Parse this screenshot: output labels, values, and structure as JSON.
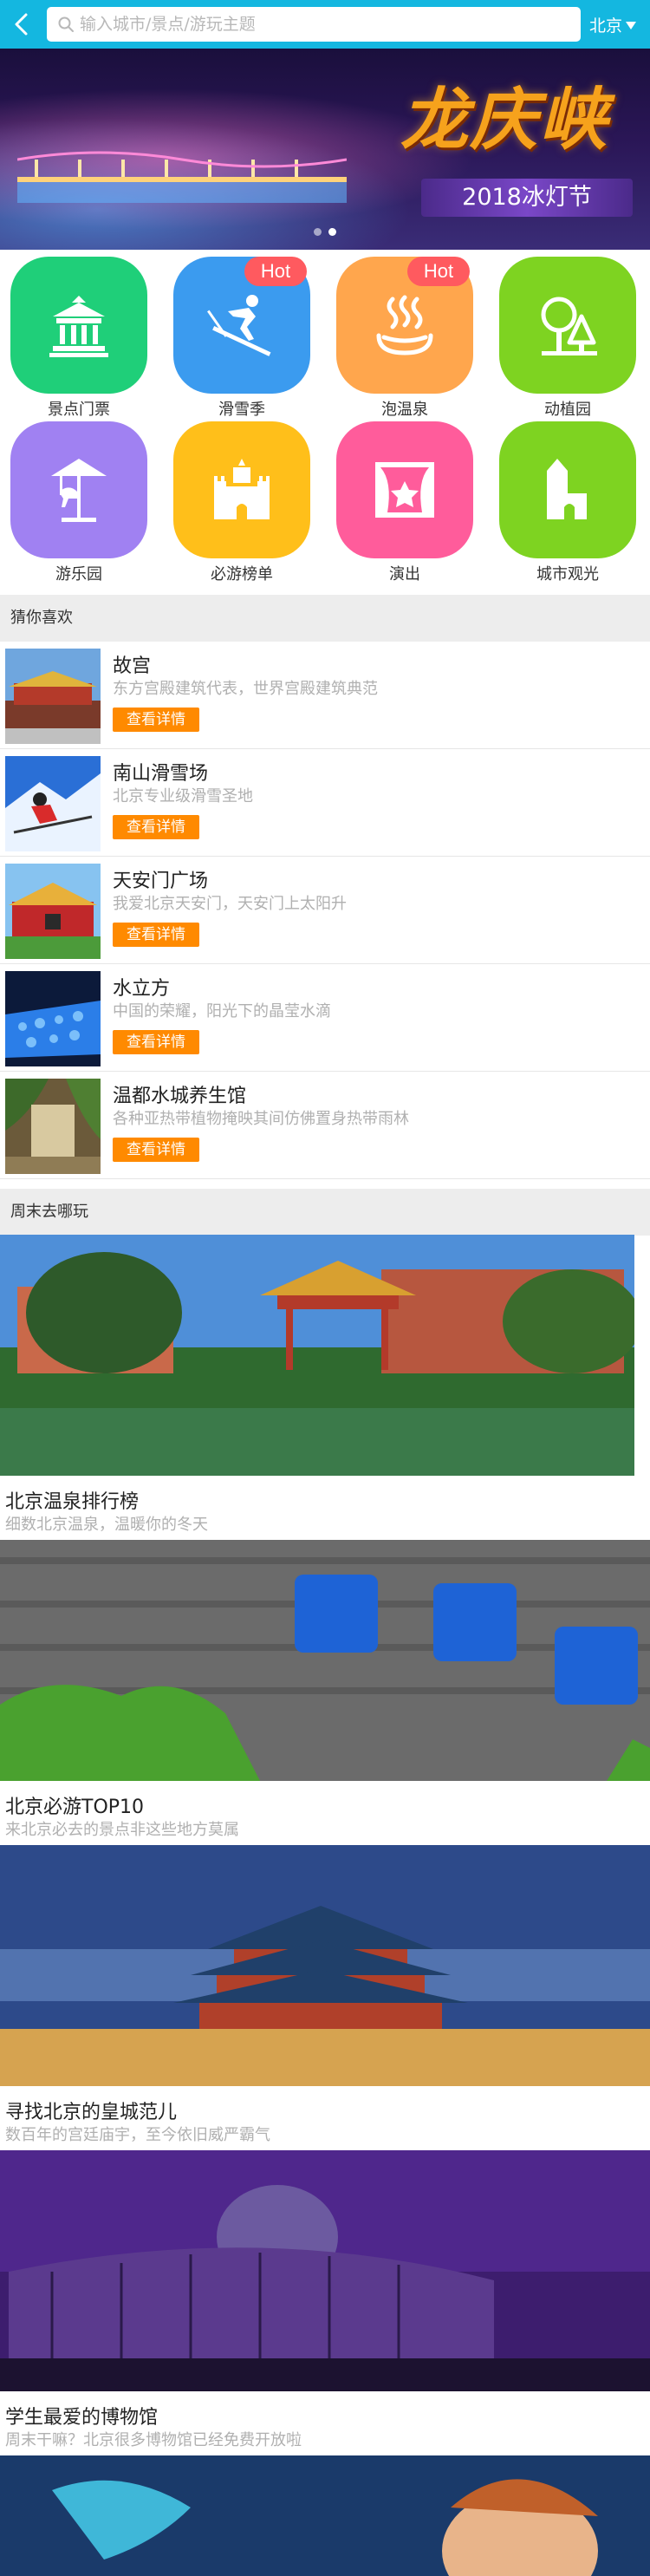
{
  "header": {
    "search_placeholder": "输入城市/景点/游玩主题",
    "city": "北京",
    "bar_color": "#14b7e0"
  },
  "banner": {
    "title": "龙庆峡",
    "subtitle": "2018冰灯节",
    "slide_count": 2,
    "active_slide": 1
  },
  "categories": [
    {
      "label": "景点门票",
      "color": "#1fcf79",
      "icon": "pavilion-icon",
      "hot": ""
    },
    {
      "label": "滑雪季",
      "color": "#3b9bef",
      "icon": "skier-icon",
      "hot": "Hot"
    },
    {
      "label": "泡温泉",
      "color": "#ffa64d",
      "icon": "hot-spring-icon",
      "hot": "Hot"
    },
    {
      "label": "动植园",
      "color": "#7ed321",
      "icon": "tree-icon",
      "hot": ""
    },
    {
      "label": "游乐园",
      "color": "#a081f2",
      "icon": "carousel-icon",
      "hot": ""
    },
    {
      "label": "必游榜单",
      "color": "#ffbf1a",
      "icon": "castle-icon",
      "hot": ""
    },
    {
      "label": "演出",
      "color": "#ff5c9b",
      "icon": "stage-icon",
      "hot": ""
    },
    {
      "label": "城市观光",
      "color": "#7ed321",
      "icon": "tower-icon",
      "hot": ""
    }
  ],
  "guess_section": {
    "title": "猜你喜欢",
    "button_label": "查看详情",
    "items": [
      {
        "title": "故宫",
        "desc": "东方宫殿建筑代表，世界宫殿建筑典范"
      },
      {
        "title": "南山滑雪场",
        "desc": "北京专业级滑雪圣地"
      },
      {
        "title": "天安门广场",
        "desc": "我爱北京天安门，天安门上太阳升"
      },
      {
        "title": "水立方",
        "desc": "中国的荣耀，阳光下的晶莹水滴"
      },
      {
        "title": "温都水城养生馆",
        "desc": "各种亚热带植物掩映其间仿佛置身热带雨林"
      }
    ]
  },
  "weekend_section": {
    "title": "周末去哪玩",
    "cards": [
      {
        "title": "北京温泉排行榜",
        "desc": "细数北京温泉，温暖你的冬天"
      },
      {
        "title": "北京必游TOP10",
        "desc": "来北京必去的景点非这些地方莫属"
      },
      {
        "title": "寻找北京的皇城范儿",
        "desc": "数百年的宫廷庙宇，至今依旧威严霸气"
      },
      {
        "title": "学生最爱的博物馆",
        "desc": "周末干嘛？北京很多博物馆已经免费开放啦"
      }
    ]
  }
}
